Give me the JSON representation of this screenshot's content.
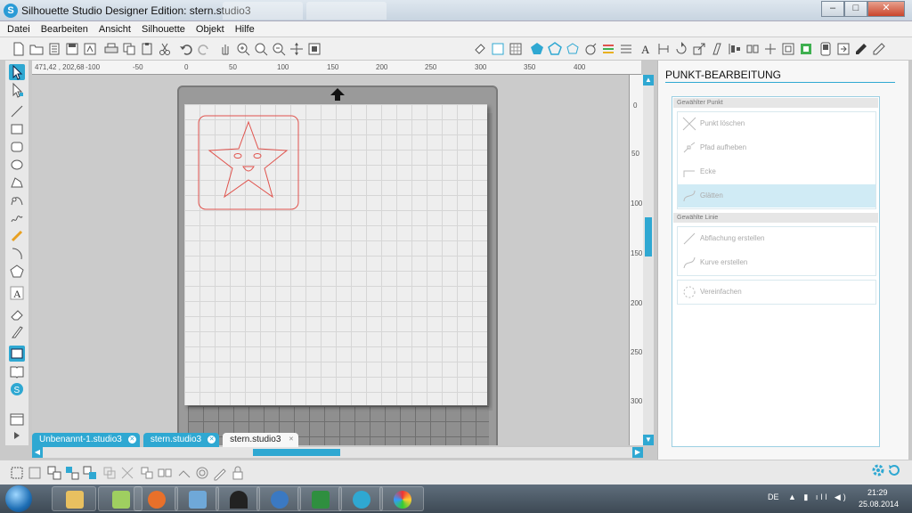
{
  "window": {
    "title": "Silhouette Studio Designer Edition: stern.studio3",
    "app_icon": "S",
    "controls": {
      "minimize": "–",
      "maximize": "□",
      "close": "✕"
    }
  },
  "menu": [
    "Datei",
    "Bearbeiten",
    "Ansicht",
    "Silhouette",
    "Objekt",
    "Hilfe"
  ],
  "ruler": {
    "coordinate": "471,42 , 202,68",
    "h_labels": [
      "-100",
      "-50",
      "0",
      "50",
      "100",
      "150",
      "200",
      "250",
      "300",
      "350",
      "400"
    ],
    "v_labels": [
      "0",
      "50",
      "100",
      "150",
      "200",
      "250",
      "300"
    ]
  },
  "doc_tabs": [
    {
      "label": "Unbenannt-1.studio3",
      "active": false
    },
    {
      "label": "stern.studio3",
      "active": false
    },
    {
      "label": "stern.studio3",
      "active": true
    }
  ],
  "panel": {
    "title": "PUNKT-BEARBEITUNG",
    "section_point": "Gewählter Punkt",
    "point_actions": [
      "Punkt löschen",
      "Pfad aufheben",
      "Ecke",
      "Glätten"
    ],
    "section_line": "Gewählte Linie",
    "line_actions": [
      "Abflachung erstellen",
      "Kurve erstellen"
    ],
    "simplify": "Vereinfachen"
  },
  "taskbar": {
    "lang": "DE",
    "time": "21:29",
    "date": "25.08.2014"
  },
  "colors": {
    "accent": "#2fa8d2",
    "design_stroke": "#e0534d",
    "page": "#eeeeee",
    "mat": "#9a9a9a"
  }
}
